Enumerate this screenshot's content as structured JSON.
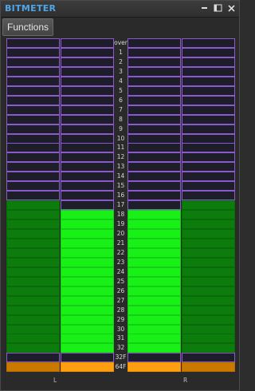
{
  "window": {
    "title": "BITMETER"
  },
  "menu": {
    "functions_label": "Functions"
  },
  "channels": {
    "left": "L",
    "right": "R"
  },
  "colors": {
    "title": "#4fa6e8",
    "cell_border": "#8a5acc",
    "dark_green": "#0c7c0c",
    "bright_green": "#18f018",
    "orange_dark": "#c97800",
    "orange_bright": "#ff9e10"
  },
  "rows": [
    {
      "label": "over",
      "state": "off"
    },
    {
      "label": "1",
      "state": "off"
    },
    {
      "label": "2",
      "state": "off"
    },
    {
      "label": "3",
      "state": "off"
    },
    {
      "label": "4",
      "state": "off"
    },
    {
      "label": "5",
      "state": "off"
    },
    {
      "label": "6",
      "state": "off"
    },
    {
      "label": "7",
      "state": "off"
    },
    {
      "label": "8",
      "state": "off"
    },
    {
      "label": "9",
      "state": "off"
    },
    {
      "label": "10",
      "state": "off"
    },
    {
      "label": "11",
      "state": "off"
    },
    {
      "label": "12",
      "state": "off"
    },
    {
      "label": "13",
      "state": "off"
    },
    {
      "label": "14",
      "state": "off"
    },
    {
      "label": "15",
      "state": "off"
    },
    {
      "label": "16",
      "state": "off"
    },
    {
      "label": "17",
      "state": "partial"
    },
    {
      "label": "18",
      "state": "on"
    },
    {
      "label": "19",
      "state": "on"
    },
    {
      "label": "20",
      "state": "on"
    },
    {
      "label": "21",
      "state": "on"
    },
    {
      "label": "22",
      "state": "on"
    },
    {
      "label": "23",
      "state": "on"
    },
    {
      "label": "24",
      "state": "on"
    },
    {
      "label": "25",
      "state": "on"
    },
    {
      "label": "26",
      "state": "on"
    },
    {
      "label": "27",
      "state": "on"
    },
    {
      "label": "28",
      "state": "on"
    },
    {
      "label": "29",
      "state": "on"
    },
    {
      "label": "30",
      "state": "on"
    },
    {
      "label": "31",
      "state": "on"
    },
    {
      "label": "32",
      "state": "on"
    },
    {
      "label": "32F",
      "state": "off"
    },
    {
      "label": "64F",
      "state": "float"
    }
  ]
}
